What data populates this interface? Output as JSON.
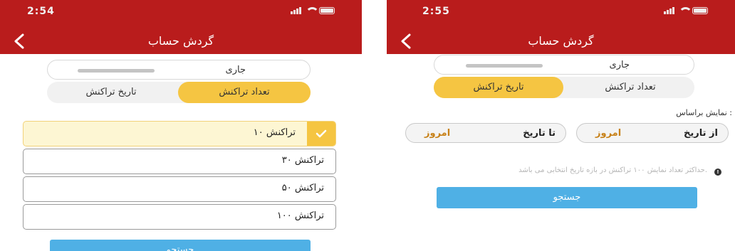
{
  "screens": [
    {
      "status": {
        "time": "2:54"
      },
      "header": {
        "title": "گردش حساب"
      },
      "account": {
        "type_label": "جاری"
      },
      "tabs": [
        {
          "label": "تعداد تراکنش",
          "active": true
        },
        {
          "label": "تاریخ تراکنش",
          "active": false
        }
      ],
      "options": [
        {
          "label": "۱۰ تراکنش",
          "selected": true
        },
        {
          "label": "۳۰ تراکنش",
          "selected": false
        },
        {
          "label": "۵۰ تراکنش",
          "selected": false
        },
        {
          "label": "۱۰۰ تراکنش",
          "selected": false
        }
      ],
      "search_label": "جستجو"
    },
    {
      "status": {
        "time": "2:55"
      },
      "header": {
        "title": "گردش حساب"
      },
      "account": {
        "type_label": "جاری"
      },
      "tabs": [
        {
          "label": "تعداد تراکنش",
          "active": false
        },
        {
          "label": "تاریخ تراکنش",
          "active": true
        }
      ],
      "filter_heading": "نمایش براساس :",
      "from_date": {
        "label": "از تاریخ",
        "value": "امروز"
      },
      "to_date": {
        "label": "تا تاریخ",
        "value": "امروز"
      },
      "info_note": "حداکثر تعداد نمایش ۱۰۰ تراکنش در بازه تاریخ انتخابی می باشد.",
      "search_label": "جستجو"
    }
  ],
  "colors": {
    "header": "#b91c1c",
    "accent_yellow": "#f5c542",
    "search_blue": "#4fb0e5",
    "date_value": "#c8821a"
  }
}
